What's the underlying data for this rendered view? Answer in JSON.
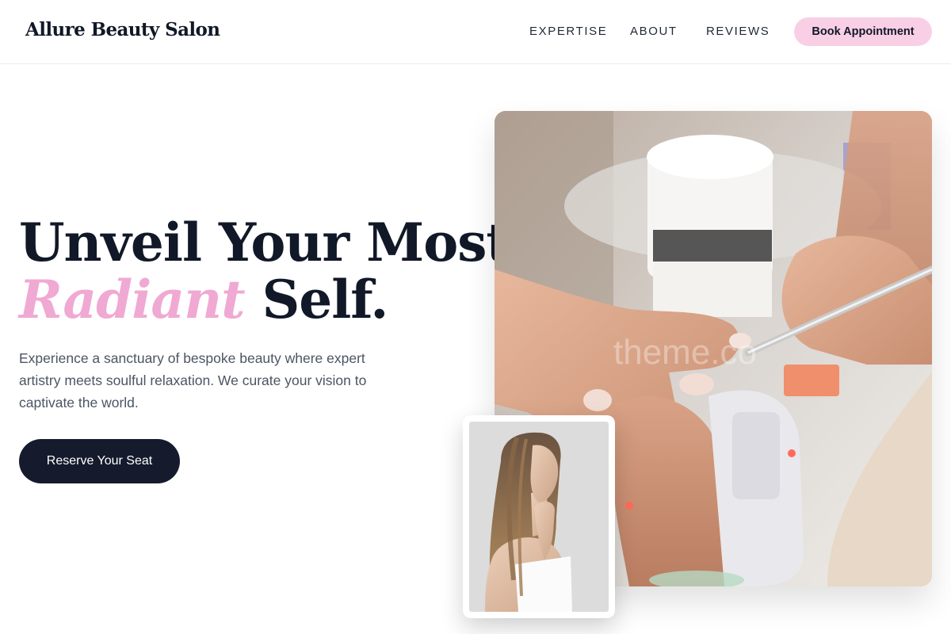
{
  "header": {
    "logo": "Allure Beauty Salon",
    "nav": [
      {
        "label": "EXPERTISE"
      },
      {
        "label": "ABOUT"
      },
      {
        "label": "REVIEWS"
      }
    ],
    "cta_label": "Book Appointment"
  },
  "hero": {
    "title_line1": "Unveil Your Most",
    "title_accent": "Radiant",
    "title_line2_rest": " Self.",
    "description": "Experience a sanctuary of bespoke beauty where expert artistry meets soulful relaxation. We curate your vision to captivate the world.",
    "button_label": "Reserve Your Seat"
  },
  "images": {
    "main_watermark": "theme.co",
    "main_alt": "manicure-photo",
    "portrait_alt": "model-portrait"
  },
  "colors": {
    "accent_pink": "#f0a9d3",
    "button_pink": "#f9cfe6",
    "dark": "#151b2c"
  }
}
